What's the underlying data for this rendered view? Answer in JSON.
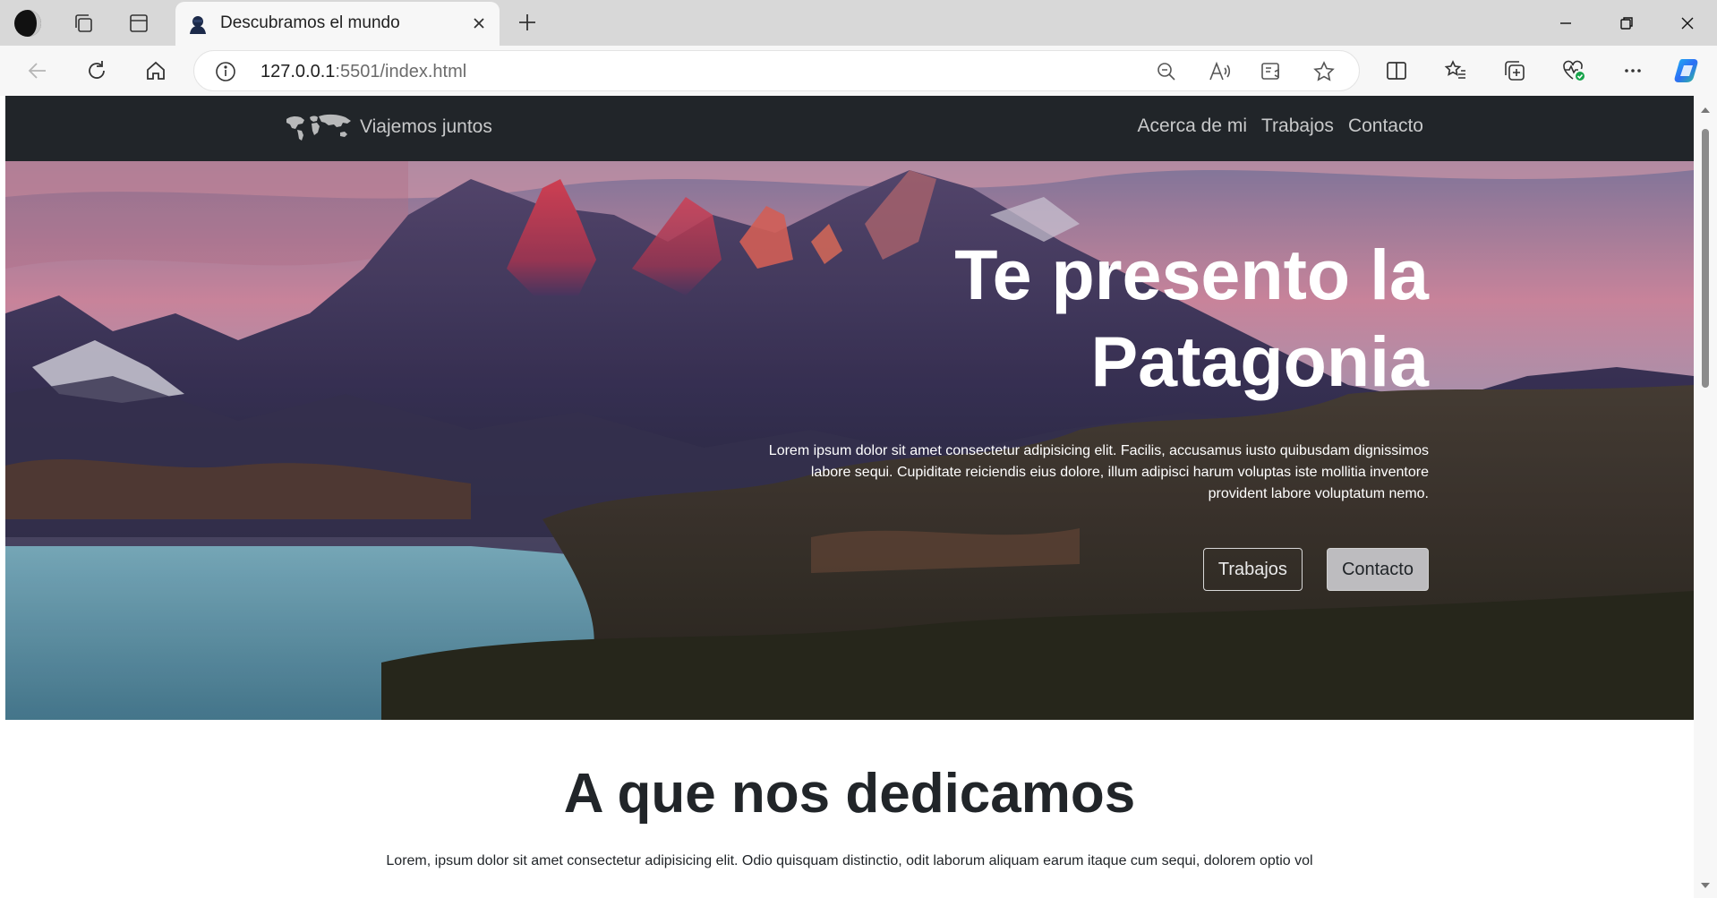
{
  "browser": {
    "tab_title": "Descubramos el mundo",
    "url_host": "127.0.0.1",
    "url_path": ":5501/index.html"
  },
  "nav": {
    "brand": "Viajemos juntos",
    "links": [
      "Acerca de mi",
      "Trabajos",
      "Contacto"
    ]
  },
  "hero": {
    "title_line1": "Te presento la",
    "title_line2": "Patagonia",
    "text": "Lorem ipsum dolor sit amet consectetur adipisicing elit. Facilis, accusamus iusto quibusdam dignissimos labore sequi. Cupiditate reiciendis eius dolore, illum adipisci harum voluptas iste mollitia inventore provident labore voluptatum nemo.",
    "button_works": "Trabajos",
    "button_contact": "Contacto"
  },
  "section": {
    "title": "A que nos dedicamos",
    "text": "Lorem, ipsum dolor sit amet consectetur adipisicing elit. Odio quisquam distinctio, odit laborum aliquam earum itaque cum sequi, dolorem optio vol"
  },
  "icons": {
    "profile": "profile-moon-icon",
    "workspaces": "workspaces-icon",
    "tab_actions": "vertical-tabs-icon",
    "favicon": "portrait-favicon-icon",
    "close": "close-icon",
    "new_tab": "plus-icon",
    "back": "back-arrow-icon",
    "refresh": "refresh-icon",
    "home": "home-icon",
    "info": "info-icon",
    "zoom": "zoom-out-icon",
    "read_aloud": "read-aloud-icon",
    "immersive": "immersive-reader-icon",
    "favorite": "star-icon",
    "split": "split-screen-icon",
    "favorites": "favorites-icon",
    "collections": "collections-icon",
    "performance": "heart-pulse-icon",
    "more": "more-icon",
    "copilot": "copilot-icon"
  },
  "colors": {
    "navbar": "#212529",
    "nav_text": "#c8c9ca",
    "hero_text": "#ffffff",
    "body_text": "#212529"
  }
}
